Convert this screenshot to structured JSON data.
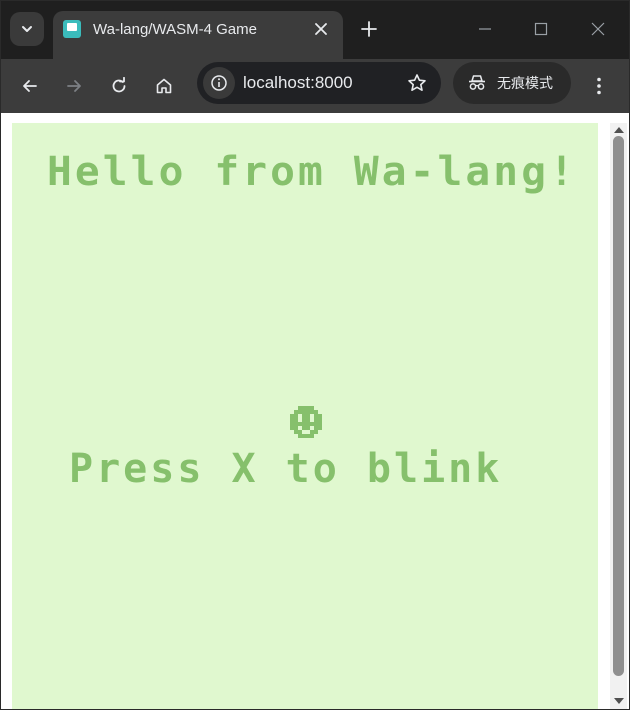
{
  "browser": {
    "tab_title": "Wa-lang/WASM-4 Game",
    "url": "localhost:8000",
    "incognito_label": "无痕模式",
    "icons": {
      "tab_search": "chevron-down-icon",
      "favicon": "wasm4-favicon-icon",
      "tab_close": "close-icon",
      "new_tab": "plus-icon",
      "minimize": "minimize-icon",
      "maximize": "maximize-icon",
      "close_window": "close-icon",
      "back": "arrow-left-icon",
      "forward": "arrow-right-icon",
      "reload": "reload-icon",
      "home": "home-icon",
      "site_info": "info-icon",
      "bookmark": "star-icon",
      "incognito": "incognito-icon",
      "menu": "kebab-menu-icon"
    }
  },
  "game": {
    "title_text": "Hello from Wa-lang!",
    "instruction_text": "Press X to blink",
    "face": "smiley-face",
    "colors": {
      "background": "#e0f8cf",
      "foreground": "#86c06c"
    }
  }
}
